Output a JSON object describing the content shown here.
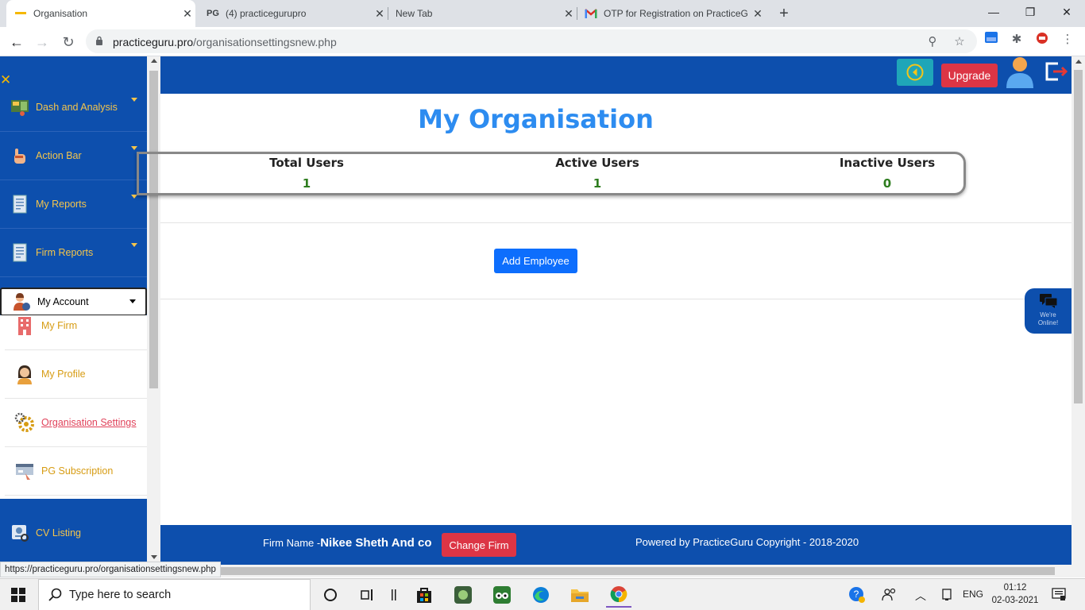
{
  "browser": {
    "tabs": [
      {
        "title": "Organisation",
        "active": true
      },
      {
        "title": "(4) practicegurupro",
        "active": false
      },
      {
        "title": "New Tab",
        "active": false
      },
      {
        "title": "OTP for Registration on PracticeG",
        "active": false
      }
    ],
    "favicon_text": "PG",
    "url_domain": "practiceguru.pro",
    "url_path": "/organisationsettingsnew.php",
    "status_url": "https://practiceguru.pro/organisationsettingsnew.php"
  },
  "header": {
    "upgrade_label": "Upgrade"
  },
  "sidebar": {
    "items": [
      {
        "label": "Dash and Analysis",
        "icon": "dashboard-icon"
      },
      {
        "label": "Action Bar",
        "icon": "hand-icon"
      },
      {
        "label": "My Reports",
        "icon": "report-icon"
      },
      {
        "label": "Firm Reports",
        "icon": "report-icon"
      },
      {
        "label": "My Account",
        "icon": "account-icon",
        "expanded": true
      }
    ],
    "account_subitems": [
      {
        "label": "My Firm",
        "icon": "building-icon"
      },
      {
        "label": "My Profile",
        "icon": "profile-icon"
      },
      {
        "label": "Organisation Settings",
        "icon": "gear-icon",
        "current": true
      },
      {
        "label": "PG Subscription",
        "icon": "subscription-icon"
      }
    ],
    "bottom_item": {
      "label": "CV Listing",
      "icon": "cv-icon"
    }
  },
  "main": {
    "title": "My Organisation",
    "stats": [
      {
        "label": "Total Users",
        "value": "1"
      },
      {
        "label": "Active Users",
        "value": "1"
      },
      {
        "label": "Inactive Users",
        "value": "0"
      }
    ],
    "add_employee_label": "Add Employee"
  },
  "chat": {
    "line1": "We're",
    "line2": "Online!"
  },
  "footer": {
    "firm_label": "Firm Name -",
    "firm_name": "Nikee Sheth And co",
    "change_firm_label": "Change Firm",
    "powered": "Powered by PracticeGuru Copyright - 2018-2020"
  },
  "taskbar": {
    "search_placeholder": "Type here to search",
    "language": "ENG",
    "time": "01:12",
    "date": "02-03-2021"
  },
  "colors": {
    "brand_blue": "#0d4fad",
    "accent_red": "#dc3545",
    "title_blue": "#2d8cf0",
    "value_green": "#2e7d1f",
    "sidebar_text": "#f5c54b"
  }
}
